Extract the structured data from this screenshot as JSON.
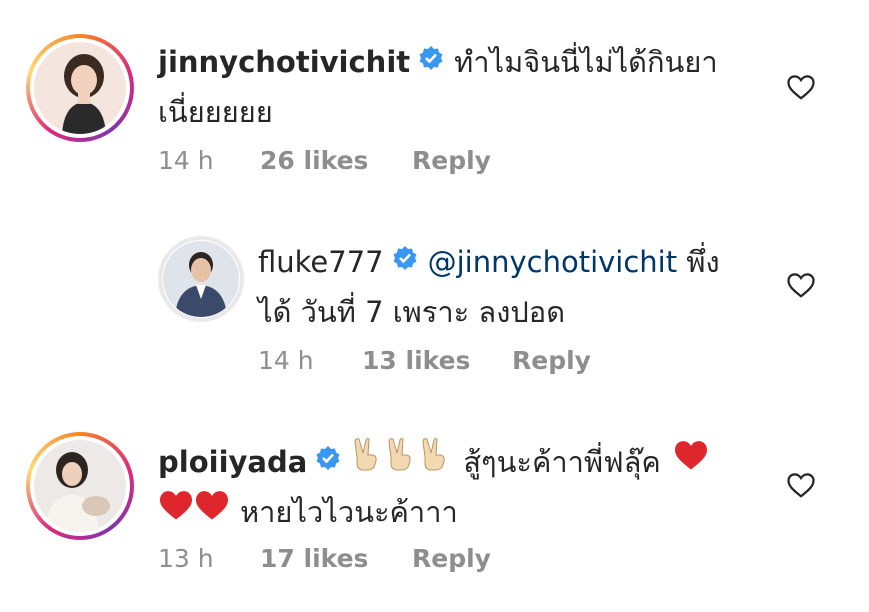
{
  "comments": [
    {
      "username": "jinnychotivichit",
      "verified": true,
      "text_line1": "ทำไมจินนี่ไม่ได้กินยา",
      "text_line2": "เนี่ยยยยย",
      "time": "14 h",
      "likes": "26 likes",
      "reply": "Reply"
    },
    {
      "username": "fluke777",
      "verified": true,
      "mention": "@jinnychotivichit",
      "text_after_mention": " พึ่ง",
      "text_line2": "ได้ วันที่ 7 เพราะ ลงปอด",
      "time": "14 h",
      "likes": "13 likes",
      "reply": "Reply"
    },
    {
      "username": "ploiiyada",
      "verified": true,
      "text_line1": "สู้ๆนะค้าาพี่ฟลุ๊ค",
      "text_line2": "หายไวไวนะค้าาา",
      "time": "13 h",
      "likes": "17 likes",
      "reply": "Reply"
    }
  ],
  "icons": {
    "verified_color": "#3897f0",
    "heart_color": "#e0262d",
    "emoji_victory": "victory-hand-emoji",
    "emoji_heart": "red-heart-emoji",
    "like_icon": "heart-outline-icon"
  }
}
